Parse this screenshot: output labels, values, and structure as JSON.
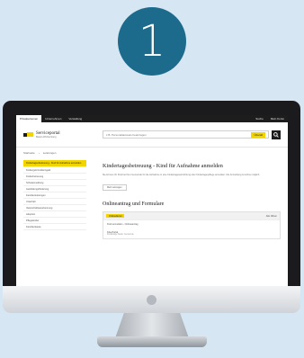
{
  "step": {
    "number": "1"
  },
  "colors": {
    "background": "#d6e6f3",
    "badge": "#1c6a8c",
    "accent": "#f2d500",
    "bezel": "#1b1b1d"
  },
  "topnav": {
    "tabs": [
      "Privatpersonen",
      "Unternehmen",
      "Verwaltung"
    ],
    "right": [
      "Suche",
      "Mein Konto"
    ]
  },
  "header": {
    "logo_name": "Serviceportal",
    "logo_sub": "Baden-Württemberg",
    "search_placeholder": "z.B. Personalausweis beantragen",
    "search_scope": "Überall",
    "search_icon": "search-icon"
  },
  "breadcrumbs": [
    "Startseite",
    "Leistungen"
  ],
  "sidebar": {
    "items": [
      "Kindergeld & Elterngeld",
      "Kinderbetreuung",
      "Schulanmeldung",
      "Ausbildungsförderung",
      "Familienleistungen",
      "Unterhalt",
      "Vaterschaftsanerkennung",
      "Adoption",
      "Pflegekinder",
      "Familienkasse"
    ],
    "active": "Kindertagesbetreuung - Kind für Aufnahme anmelden"
  },
  "main": {
    "title": "Kindertagesbetreuung - Kind für Aufnahme anmelden",
    "lead": "Sie können Ihr Kind bei Ihrer Gemeinde für die Aufnahme in eine Kindertageseinrichtung oder Kindertagespflege anmelden. Die Anmeldung ist online möglich.",
    "pill": "Mehr anzeigen",
    "section_title": "Onlineantrag und Formulare",
    "accordion_badge": "Onlinedienst",
    "accordion_right": "Alle öffnen",
    "accordion_row": "Kind anmelden - Onlineantrag",
    "accordion_sub": "Kita-Portal",
    "accordion_sub_small": "Zuständige Stelle: Gemeinde"
  }
}
